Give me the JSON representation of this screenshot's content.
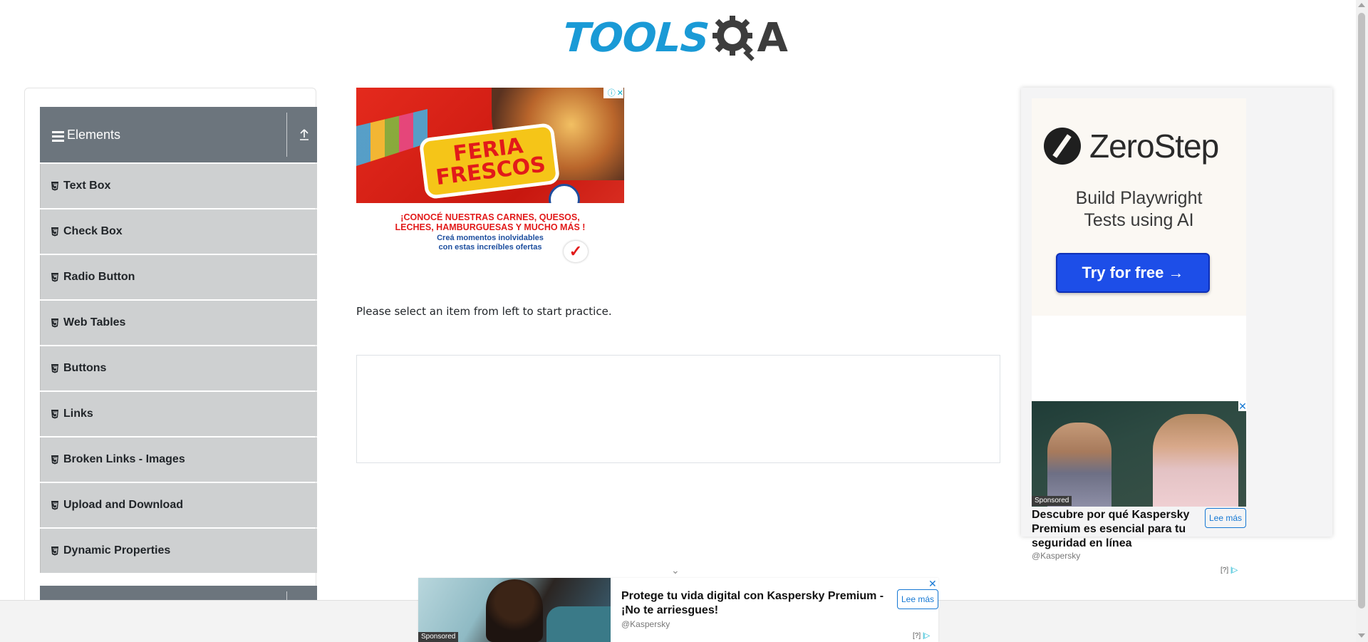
{
  "header": {
    "logo_text_tools": "TOOLS",
    "logo_text_a": "A"
  },
  "sidebar": {
    "group_title": "Elements",
    "items": [
      {
        "label": "Text Box"
      },
      {
        "label": "Check Box"
      },
      {
        "label": "Radio Button"
      },
      {
        "label": "Web Tables"
      },
      {
        "label": "Buttons"
      },
      {
        "label": "Links"
      },
      {
        "label": "Broken Links - Images"
      },
      {
        "label": "Upload and Download"
      },
      {
        "label": "Dynamic Properties"
      }
    ]
  },
  "main": {
    "ad_feria": {
      "headline_1": "FERIA",
      "headline_2": "FRESCOS",
      "tagline_1": "¡CONOCÉ NUESTRAS CARNES, QUESOS,",
      "tagline_2": "LECHES, HAMBURGUESAS Y MUCHO MÁS !",
      "sub_1": "Creá momentos inolvidables",
      "sub_2": "con estas increíbles ofertas"
    },
    "instruction": "Please select an item from left to start practice."
  },
  "right_ad": {
    "zerostep": {
      "name": "ZeroStep",
      "subtitle_1": "Build Playwright",
      "subtitle_2": "Tests using AI",
      "cta": "Try for free →"
    },
    "kaspersky": {
      "sponsored": "Sponsored",
      "title": "Descubre por qué Kaspersky Premium es esencial para tu seguridad en línea",
      "cta": "Lee más",
      "handle": "@Kaspersky",
      "help": "[?]"
    }
  },
  "bottom_ad": {
    "sponsored": "Sponsored",
    "title": "Protege tu vida digital con Kaspersky Premium - ¡No te arriesgues!",
    "cta": "Lee más",
    "handle": "@Kaspersky",
    "help": "[?]"
  },
  "colors": {
    "accent": "#1a9ad6",
    "sidebar_header": "#6c757d",
    "menu_item_bg": "#ced0d1",
    "cta_blue": "#1d4ee8"
  }
}
